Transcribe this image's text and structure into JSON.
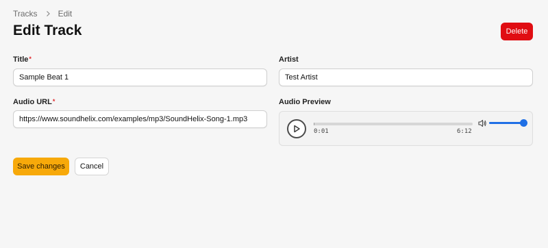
{
  "breadcrumb": {
    "items": [
      "Tracks",
      "Edit"
    ]
  },
  "page": {
    "title": "Edit Track"
  },
  "actions": {
    "delete_label": "Delete",
    "save_label": "Save changes",
    "cancel_label": "Cancel"
  },
  "form": {
    "title": {
      "label": "Title",
      "required_mark": "*",
      "value": "Sample Beat 1"
    },
    "artist": {
      "label": "Artist",
      "value": "Test Artist"
    },
    "audio_url": {
      "label": "Audio URL",
      "required_mark": "*",
      "value": "https://www.soundhelix.com/examples/mp3/SoundHelix-Song-1.mp3"
    },
    "audio_preview": {
      "label": "Audio Preview",
      "current_time": "0:01",
      "duration": "6:12",
      "progress_fraction": 0.003,
      "volume_fraction": 1.0,
      "play_icon": "play-icon",
      "volume_icon": "volume-icon"
    }
  },
  "colors": {
    "danger": "#e00d12",
    "primary": "#f7a90a",
    "accent": "#1f6fe5"
  }
}
